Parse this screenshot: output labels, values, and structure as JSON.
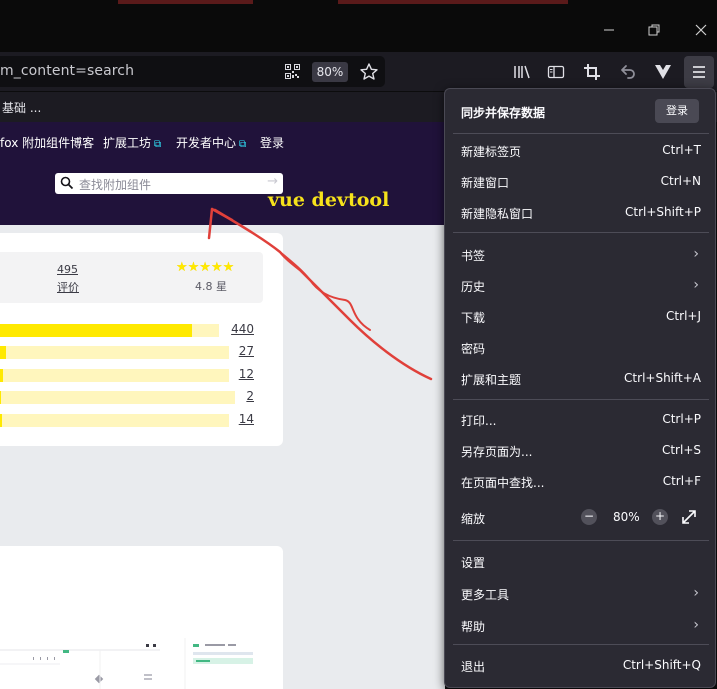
{
  "toolbar": {
    "url_text": "m_content=search",
    "zoom": "80%"
  },
  "bookmarks": {
    "item": "基础 ..."
  },
  "site": {
    "nav": [
      "fox 附加组件博客",
      "扩展工坊",
      "开发者中心",
      "登录"
    ],
    "search_placeholder": "查找附加组件",
    "review_count": "495",
    "review_label": "评价",
    "stars": "★★★★★",
    "rating": "4.8 星",
    "rating_bars": [
      {
        "count": "440",
        "fraction": 0.88
      },
      {
        "count": "27",
        "fraction": 0.03
      },
      {
        "count": "12",
        "fraction": 0.0
      },
      {
        "count": "2",
        "fraction": 0.0
      },
      {
        "count": "14",
        "fraction": 0.0
      }
    ]
  },
  "annotation": {
    "text": "vue devtool",
    "color": "#e0403a"
  },
  "menu": {
    "sync_title": "同步并保存数据",
    "sign_in": "登录",
    "items": [
      {
        "label": "新建标签页",
        "shortcut": "Ctrl+T"
      },
      {
        "label": "新建窗口",
        "shortcut": "Ctrl+N"
      },
      {
        "label": "新建隐私窗口",
        "shortcut": "Ctrl+Shift+P"
      },
      {
        "label": "书签",
        "shortcut": ""
      },
      {
        "label": "历史",
        "shortcut": ""
      },
      {
        "label": "下载",
        "shortcut": "Ctrl+J"
      },
      {
        "label": "密码",
        "shortcut": ""
      },
      {
        "label": "扩展和主题",
        "shortcut": "Ctrl+Shift+A"
      },
      {
        "label": "打印...",
        "shortcut": "Ctrl+P"
      },
      {
        "label": "另存页面为...",
        "shortcut": "Ctrl+S"
      },
      {
        "label": "在页面中查找...",
        "shortcut": "Ctrl+F"
      },
      {
        "label": "缩放",
        "shortcut": ""
      },
      {
        "label": "设置",
        "shortcut": ""
      },
      {
        "label": "更多工具",
        "shortcut": ""
      },
      {
        "label": "帮助",
        "shortcut": ""
      },
      {
        "label": "退出",
        "shortcut": "Ctrl+Shift+Q"
      }
    ],
    "zoom_minus": "−",
    "zoom_value": "80%",
    "zoom_plus": "+"
  }
}
